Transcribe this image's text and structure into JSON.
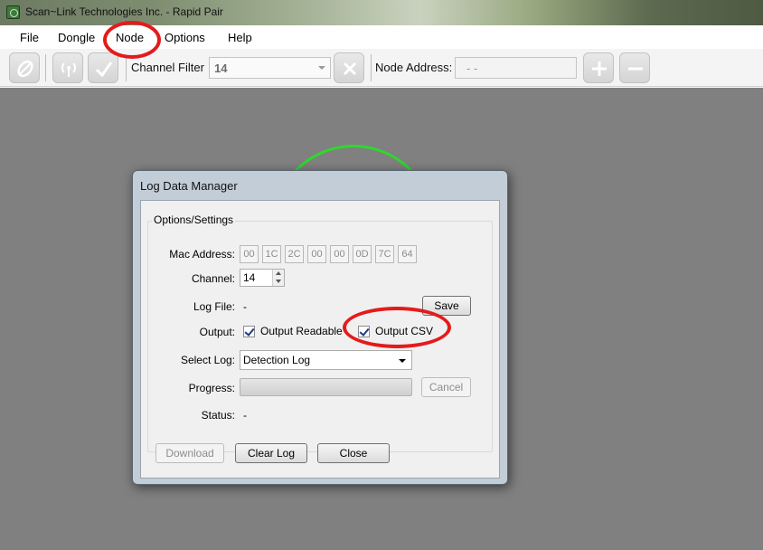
{
  "window": {
    "title": "Scan~Link Technologies Inc. - Rapid Pair"
  },
  "menu": {
    "items": [
      "File",
      "Dongle",
      "Node",
      "Options",
      "Help"
    ]
  },
  "toolbar": {
    "channel_filter_label": "Channel Filter",
    "channel_filter_value": "14",
    "node_address_label": "Node Address:",
    "node_address_value": "- -"
  },
  "dialog": {
    "title": "Log Data Manager",
    "group_title": "Options/Settings",
    "mac_label": "Mac Address:",
    "mac_bytes": [
      "00",
      "1C",
      "2C",
      "00",
      "00",
      "0D",
      "7C",
      "64"
    ],
    "channel_label": "Channel:",
    "channel_value": "14",
    "logfile_label": "Log File:",
    "logfile_value": "-",
    "save_label": "Save",
    "output_label": "Output:",
    "output_readable_label": "Output Readable",
    "output_readable_checked": true,
    "output_csv_label": "Output CSV",
    "output_csv_checked": true,
    "select_log_label": "Select Log:",
    "select_log_value": "Detection Log",
    "progress_label": "Progress:",
    "progress_value": 0,
    "cancel_label": "Cancel",
    "status_label": "Status:",
    "status_value": "-",
    "download_label": "Download",
    "clear_log_label": "Clear Log",
    "close_label": "Close"
  },
  "colors": {
    "annotation": "#e41b1b",
    "workspace": "#808080",
    "node_ring": "#2fd72f",
    "node_tile": "#c9a235"
  }
}
